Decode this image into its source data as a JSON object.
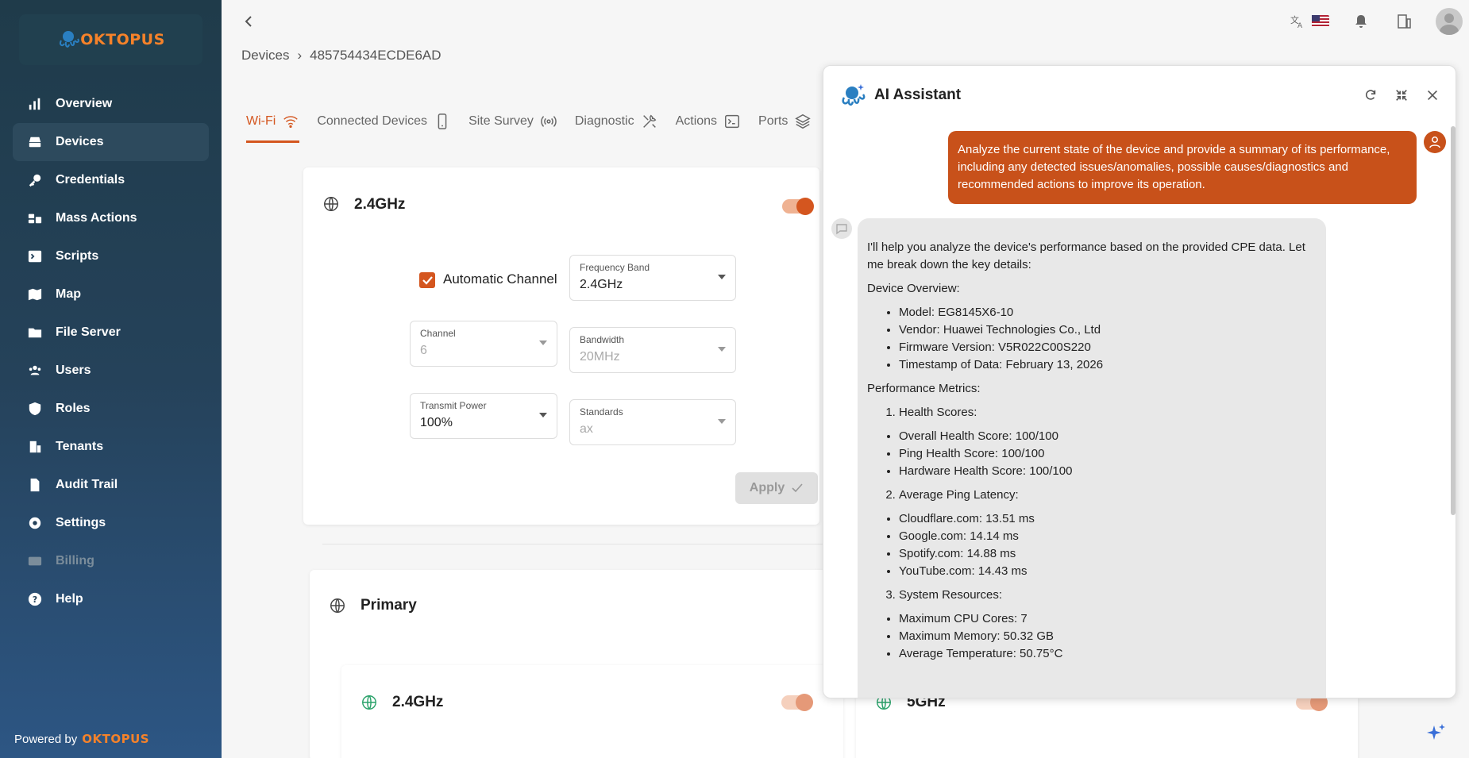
{
  "brand": {
    "logo_text": "OKTOPUS",
    "powered_by": "Powered by"
  },
  "sidebar": {
    "items": [
      {
        "label": "Overview",
        "icon": "bar-chart-icon"
      },
      {
        "label": "Devices",
        "icon": "router-icon"
      },
      {
        "label": "Credentials",
        "icon": "key-icon"
      },
      {
        "label": "Mass Actions",
        "icon": "mass-actions-icon"
      },
      {
        "label": "Scripts",
        "icon": "terminal-icon"
      },
      {
        "label": "Map",
        "icon": "map-icon"
      },
      {
        "label": "File Server",
        "icon": "folder-icon"
      },
      {
        "label": "Users",
        "icon": "users-icon"
      },
      {
        "label": "Roles",
        "icon": "shield-icon"
      },
      {
        "label": "Tenants",
        "icon": "building-icon"
      },
      {
        "label": "Audit Trail",
        "icon": "audit-icon"
      },
      {
        "label": "Settings",
        "icon": "gear-icon"
      },
      {
        "label": "Billing",
        "icon": "credit-card-icon"
      },
      {
        "label": "Help",
        "icon": "help-icon"
      }
    ]
  },
  "breadcrumb": {
    "root": "Devices",
    "sep": "›",
    "current": "485754434ECDE6AD"
  },
  "tabs": [
    {
      "label": "Wi-Fi"
    },
    {
      "label": "Connected Devices"
    },
    {
      "label": "Site Survey"
    },
    {
      "label": "Diagnostic"
    },
    {
      "label": "Actions"
    },
    {
      "label": "Ports"
    }
  ],
  "wifi_card": {
    "title": "2.4GHz",
    "enabled": true,
    "auto_channel_label": "Automatic Channel",
    "auto_channel_checked": true,
    "frequency_band": {
      "label": "Frequency Band",
      "value": "2.4GHz"
    },
    "channel": {
      "label": "Channel",
      "value": "6"
    },
    "bandwidth": {
      "label": "Bandwidth",
      "value": "20MHz"
    },
    "transmit_power": {
      "label": "Transmit Power",
      "value": "100%"
    },
    "standards": {
      "label": "Standards",
      "value": "ax"
    },
    "apply_label": "Apply"
  },
  "primary_card": {
    "title": "Primary",
    "sub_24": "2.4GHz",
    "sub_5": "5GHz"
  },
  "ai": {
    "title": "AI Assistant",
    "user_message": "Analyze the current state of the device and provide a summary of its performance, including any detected issues/anomalies, possible causes/diagnostics and recommended actions to improve its operation.",
    "intro": "I'll help you analyze the device's performance based on the provided CPE data. Let me break down the key details:",
    "overview_heading": "Device Overview:",
    "overview": [
      "Model: EG8145X6-10",
      "Vendor: Huawei Technologies Co., Ltd",
      "Firmware Version: V5R022C00S220",
      "Timestamp of Data: February 13, 2026"
    ],
    "metrics_heading": "Performance Metrics:",
    "health_heading": "Health Scores:",
    "health": [
      "Overall Health Score: 100/100",
      "Ping Health Score: 100/100",
      "Hardware Health Score: 100/100"
    ],
    "ping_heading": "Average Ping Latency:",
    "ping": [
      "Cloudflare.com: 13.51 ms",
      "Google.com: 14.14 ms",
      "Spotify.com: 14.88 ms",
      "YouTube.com: 14.43 ms"
    ],
    "resources_heading": "System Resources:",
    "resources": [
      "Maximum CPU Cores: 7",
      "Maximum Memory: 50.32 GB",
      "Average Temperature: 50.75°C"
    ]
  },
  "colors": {
    "accent": "#d4561f",
    "sidebar": "#25425a"
  }
}
